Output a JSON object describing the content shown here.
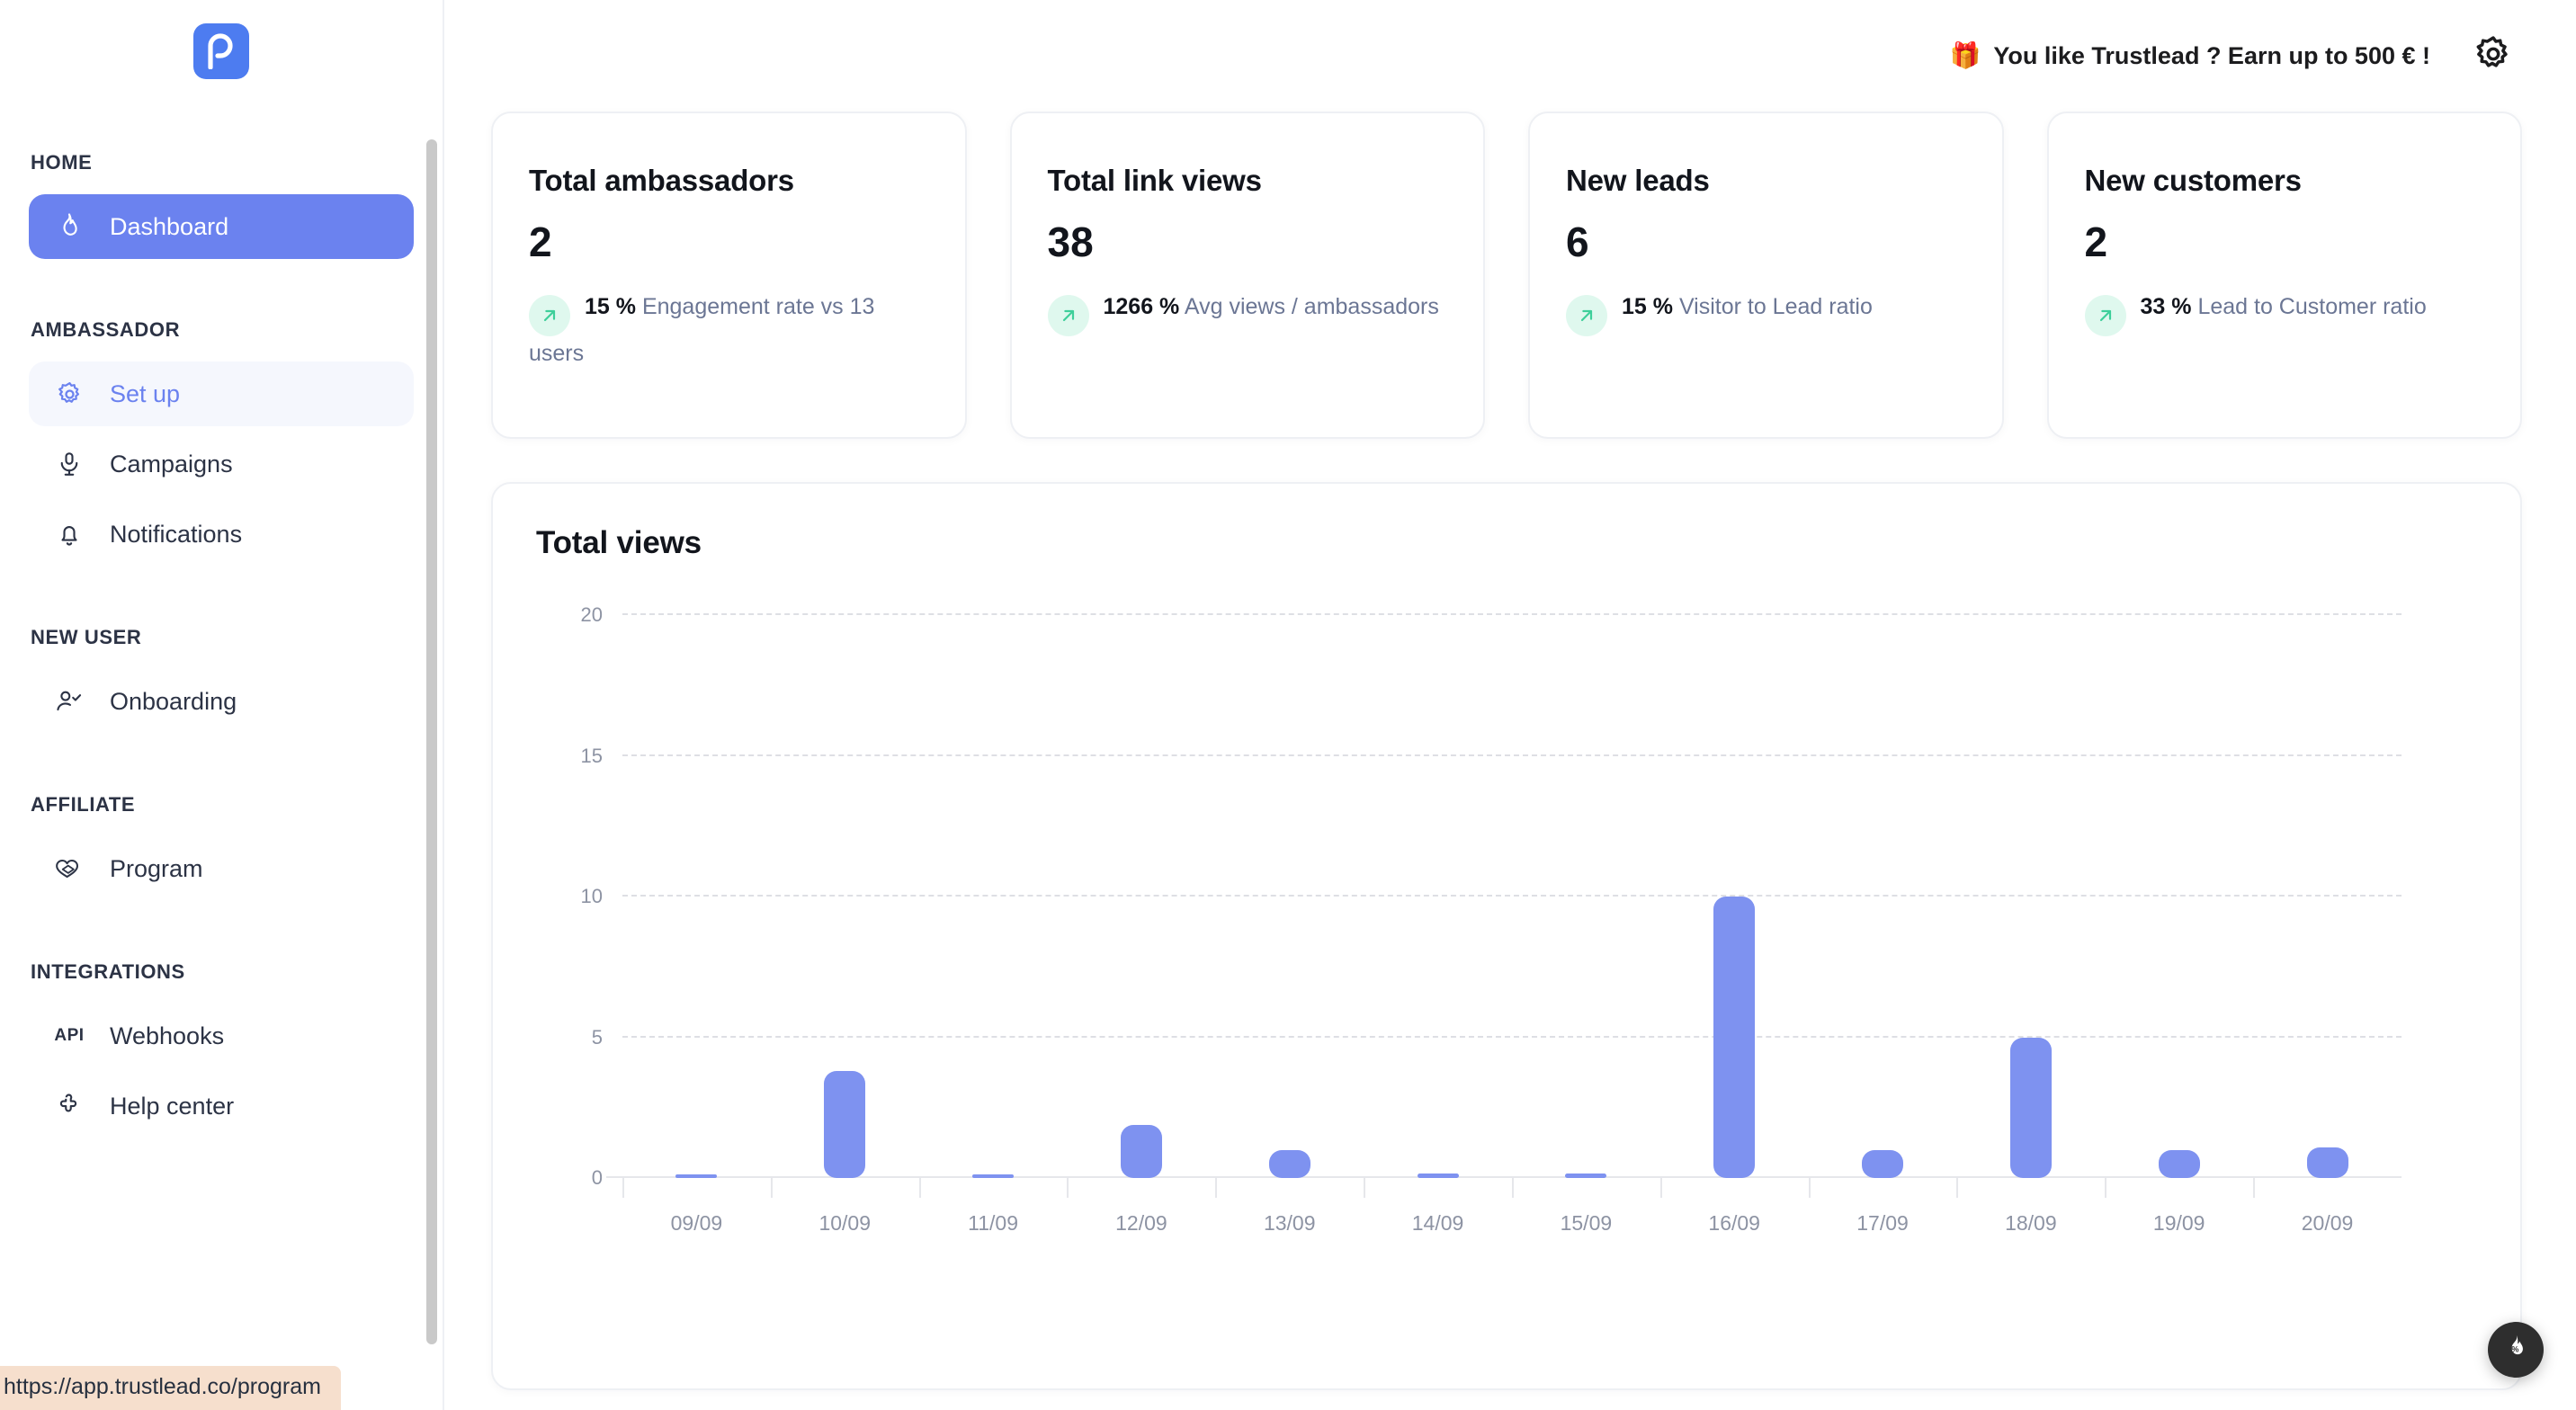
{
  "brand": {
    "logo_letter": "p",
    "logo_color": "#4d7cf0"
  },
  "topbar": {
    "promo_icon": "gift-icon",
    "promo_text": "You like Trustlead ? Earn up to 500 € !",
    "settings_icon": "gear-icon"
  },
  "sidebar": {
    "sections": [
      {
        "label": "HOME",
        "items": [
          {
            "label": "Dashboard",
            "icon": "flame-icon",
            "state": "active"
          }
        ]
      },
      {
        "label": "AMBASSADOR",
        "items": [
          {
            "label": "Set up",
            "icon": "gear-icon",
            "state": "soft"
          },
          {
            "label": "Campaigns",
            "icon": "microphone-icon",
            "state": "default"
          },
          {
            "label": "Notifications",
            "icon": "bell-icon",
            "state": "default"
          }
        ]
      },
      {
        "label": "NEW USER",
        "items": [
          {
            "label": "Onboarding",
            "icon": "user-check-icon",
            "state": "default"
          }
        ]
      },
      {
        "label": "AFFILIATE",
        "items": [
          {
            "label": "Program",
            "icon": "handshake-icon",
            "state": "default"
          }
        ]
      },
      {
        "label": "INTEGRATIONS",
        "items": [
          {
            "label": "Webhooks",
            "icon": "api-icon",
            "state": "default"
          },
          {
            "label": "Help center",
            "icon": "puzzle-icon",
            "state": "default"
          }
        ]
      }
    ]
  },
  "cards": [
    {
      "title": "Total ambassadors",
      "value": "2",
      "delta_pct": "15 %",
      "delta_label": "Engagement rate vs 13 users",
      "trend_icon": "arrow-up-right-icon"
    },
    {
      "title": "Total link views",
      "value": "38",
      "delta_pct": "1266 %",
      "delta_label": "Avg views / ambassadors",
      "trend_icon": "arrow-up-right-icon"
    },
    {
      "title": "New leads",
      "value": "6",
      "delta_pct": "15 %",
      "delta_label": "Visitor to Lead ratio",
      "trend_icon": "arrow-up-right-icon"
    },
    {
      "title": "New customers",
      "value": "2",
      "delta_pct": "33 %",
      "delta_label": "Lead to Customer ratio",
      "trend_icon": "arrow-up-right-icon"
    }
  ],
  "panel": {
    "title": "Total views"
  },
  "chart_data": {
    "type": "bar",
    "title": "Total views",
    "xlabel": "",
    "ylabel": "",
    "categories": [
      "09/09",
      "10/09",
      "11/09",
      "12/09",
      "13/09",
      "14/09",
      "15/09",
      "16/09",
      "17/09",
      "18/09",
      "19/09",
      "20/09"
    ],
    "values": [
      0.1,
      3.8,
      0.1,
      1.9,
      1.0,
      0.15,
      0.15,
      10.0,
      1.0,
      5.0,
      1.0,
      1.1
    ],
    "ylim": [
      0,
      20
    ],
    "yticks": [
      0,
      5,
      10,
      15,
      20
    ],
    "grid": true,
    "legend": "none",
    "bar_color": "#7e92f0"
  },
  "fab": {
    "icon": "flame-percent-icon"
  },
  "statusbar": {
    "url": "https://app.trustlead.co/program"
  },
  "colors": {
    "accent": "#6b82ef",
    "accent_soft_bg": "#f5f7fd",
    "bar": "#7e92f0",
    "trend_bg": "#dff8ee",
    "trend_fg": "#3ecf9a",
    "status_bg": "#f6dfcd"
  }
}
